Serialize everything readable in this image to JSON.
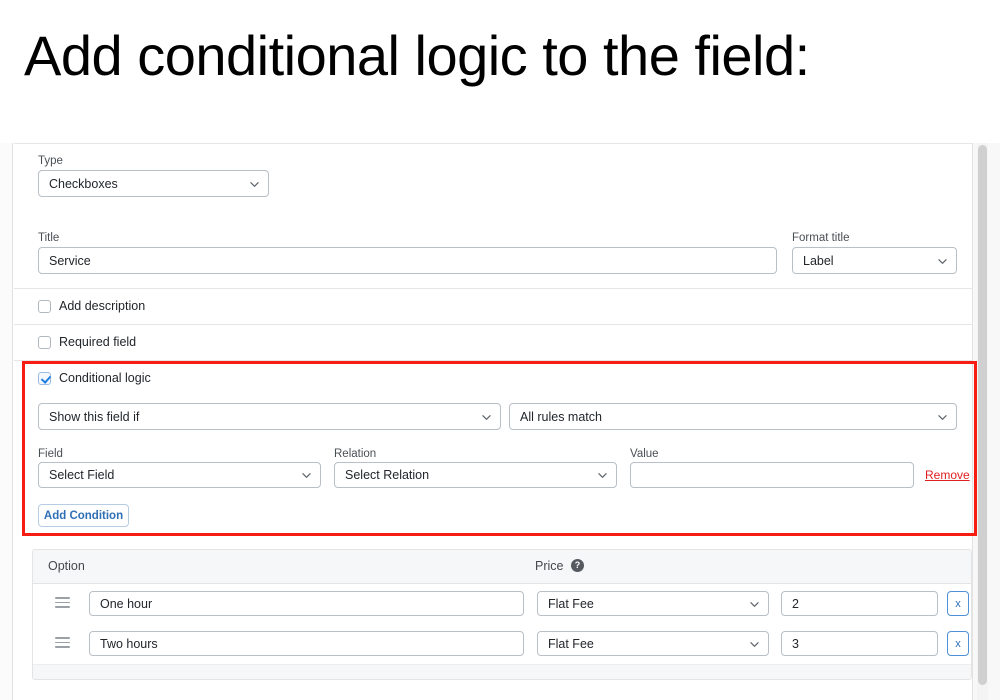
{
  "heading": "Add conditional logic to the field:",
  "form": {
    "type": {
      "label": "Type",
      "value": "Checkboxes"
    },
    "title": {
      "label": "Title",
      "value": "Service"
    },
    "format_title": {
      "label": "Format title",
      "value": "Label"
    },
    "checkboxes": [
      {
        "label": "Add description",
        "checked": false
      },
      {
        "label": "Required field",
        "checked": false
      },
      {
        "label": "Conditional logic",
        "checked": true
      }
    ]
  },
  "conditional_logic": {
    "visibility_rule": "Show this field if",
    "match_rule": "All rules match",
    "condition": {
      "field_label": "Field",
      "field_value": "Select Field",
      "relation_label": "Relation",
      "relation_value": "Select Relation",
      "value_label": "Value",
      "value_value": "",
      "value_placeholder": "",
      "remove_label": "Remove"
    },
    "add_condition_label": "Add Condition",
    "highlight_color": "#f81d12"
  },
  "options_table": {
    "headers": {
      "option": "Option",
      "price": "Price",
      "price_help": "?"
    },
    "rows": [
      {
        "option": "One hour",
        "price_type": "Flat Fee",
        "price": "2",
        "delete_label": "x"
      },
      {
        "option": "Two hours",
        "price_type": "Flat Fee",
        "price": "3",
        "delete_label": "x"
      }
    ]
  }
}
